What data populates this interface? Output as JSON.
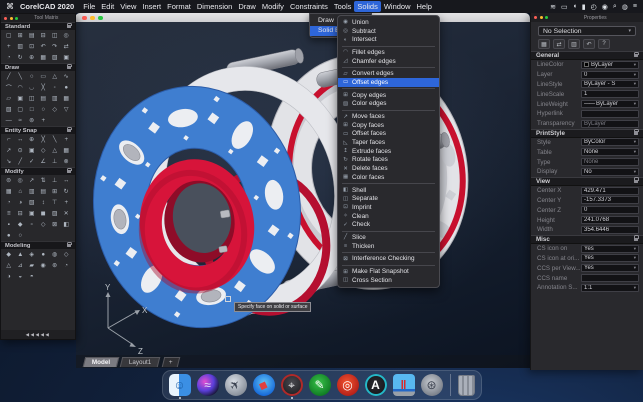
{
  "colors": {
    "accent_blue": "#2e66d9",
    "selection_blue": "#3f7ed0",
    "hub_red": "#d7143a",
    "titlebar_gray": "#d4d4d6"
  },
  "menubar": {
    "apple_logo": "⌘",
    "app_name": "CorelCAD 2020",
    "menus": [
      "File",
      "Edit",
      "View",
      "Insert",
      "Format",
      "Dimension",
      "Draw",
      "Modify",
      "Constraints",
      "Tools",
      "Solids",
      "Window",
      "Help"
    ],
    "active_menu": "Solids",
    "status_icons": [
      {
        "name": "wifi-icon",
        "glyph": "≋"
      },
      {
        "name": "display-icon",
        "glyph": "▭"
      },
      {
        "name": "volume-icon",
        "glyph": "◖"
      },
      {
        "name": "battery-icon",
        "glyph": "▮"
      },
      {
        "name": "clock-icon",
        "glyph": "◴"
      },
      {
        "name": "user-icon",
        "glyph": "◉"
      },
      {
        "name": "search-icon",
        "glyph": "⌕"
      },
      {
        "name": "siri-icon",
        "glyph": "◍"
      },
      {
        "name": "menu-list-icon",
        "glyph": "≡"
      }
    ]
  },
  "solids_menu": {
    "items": [
      {
        "label": "Draw",
        "active": false
      },
      {
        "label": "Solid Editing",
        "active": true
      }
    ]
  },
  "solid_editing_submenu": {
    "highlighted": "Offset edges",
    "groups": [
      [
        {
          "label": "Union",
          "glyph": "◉"
        },
        {
          "label": "Subtract",
          "glyph": "◎"
        },
        {
          "label": "Intersect",
          "glyph": "◐"
        }
      ],
      [
        {
          "label": "Fillet edges",
          "glyph": "◠"
        },
        {
          "label": "Chamfer edges",
          "glyph": "◿"
        }
      ],
      [
        {
          "label": "Convert edges",
          "glyph": "▱"
        },
        {
          "label": "Offset edges",
          "glyph": "▭"
        }
      ],
      [
        {
          "label": "Copy edges",
          "glyph": "⊞"
        },
        {
          "label": "Color edges",
          "glyph": "▨"
        }
      ],
      [
        {
          "label": "Move faces",
          "glyph": "↗"
        },
        {
          "label": "Copy faces",
          "glyph": "⊞"
        },
        {
          "label": "Offset faces",
          "glyph": "▭"
        },
        {
          "label": "Taper faces",
          "glyph": "◺"
        },
        {
          "label": "Extrude faces",
          "glyph": "↥"
        },
        {
          "label": "Rotate faces",
          "glyph": "↻"
        },
        {
          "label": "Delete faces",
          "glyph": "✕"
        },
        {
          "label": "Color faces",
          "glyph": "▦"
        }
      ],
      [
        {
          "label": "Shell",
          "glyph": "◧"
        },
        {
          "label": "Separate",
          "glyph": "◫"
        },
        {
          "label": "Imprint",
          "glyph": "⊡"
        },
        {
          "label": "Clean",
          "glyph": "✧"
        },
        {
          "label": "Check",
          "glyph": "✓"
        }
      ],
      [
        {
          "label": "Slice",
          "glyph": "╱"
        },
        {
          "label": "Thicken",
          "glyph": "≡"
        }
      ],
      [
        {
          "label": "Interference Checking",
          "glyph": "⊠"
        }
      ],
      [
        {
          "label": "Make Flat Snapshot",
          "glyph": "⊞"
        },
        {
          "label": "Cross Section",
          "glyph": "◫"
        }
      ]
    ]
  },
  "tool_matrix": {
    "title": "Tool Matrix",
    "pager": "◀◀◀◀◀",
    "sections": [
      {
        "name": "Standard",
        "icons": [
          "▢",
          "⊞",
          "▤",
          "⊟",
          "◫",
          "◎",
          "+",
          "▥",
          "⊡",
          "↶",
          "↷",
          "⇄",
          "◔",
          "↻",
          "⊕",
          "▦",
          "▧",
          "▣"
        ]
      },
      {
        "name": "Draw",
        "icons": [
          "╱",
          "╲",
          "○",
          "▭",
          "△",
          "∿",
          "⌒",
          "◠",
          "◡",
          "╳",
          "◦",
          "●",
          "▱",
          "▣",
          "◫",
          "▤",
          "▥",
          "▦",
          "▧",
          "▢",
          "□",
          "○",
          "◇",
          "▽",
          "―",
          "≈",
          "⊚",
          "+"
        ]
      },
      {
        "name": "Entity Snap",
        "icons": [
          "⌐",
          "↔",
          "⊕",
          "╳",
          "╲",
          "+",
          "↗",
          "⊙",
          "▣",
          "◇",
          "△",
          "▦",
          "↘",
          "╱",
          "✓",
          "∠",
          "⊥",
          "⊗"
        ]
      },
      {
        "name": "Modify",
        "icons": [
          "⊜",
          "◎",
          "↗",
          "⇅",
          "⊥",
          "↔",
          "▦",
          "⌂",
          "▥",
          "▤",
          "⊞",
          "↻",
          "◔",
          "◑",
          "▧",
          "↕",
          "⊤",
          "+",
          "≡",
          "⊟",
          "▣",
          "◼",
          "▨",
          "✕",
          "▪",
          "◆",
          "▫",
          "◇",
          "⊠",
          "◧",
          "●",
          "○"
        ]
      },
      {
        "name": "Modeling",
        "icons": [
          "◆",
          "▲",
          "◈",
          "●",
          "◍",
          "◇",
          "△",
          "⊿",
          "▰",
          "◉",
          "⊛",
          "◔",
          "◑",
          "◒",
          "◓"
        ]
      }
    ]
  },
  "viewport": {
    "tooltip": "Specify face on solid or surface",
    "axis": {
      "x": "X",
      "y": "Y",
      "z": "Z"
    },
    "tabs": [
      {
        "label": "Model",
        "active": true
      },
      {
        "label": "Layout1",
        "active": false
      },
      {
        "label": "+",
        "active": false
      }
    ]
  },
  "properties": {
    "title": "Properties",
    "selector": "No Selection",
    "toolbar_icons": [
      {
        "name": "match-properties-icon",
        "glyph": "▦"
      },
      {
        "name": "swap-icon",
        "glyph": "⇄"
      },
      {
        "name": "table-icon",
        "glyph": "▥"
      },
      {
        "name": "undo-icon",
        "glyph": "↶"
      },
      {
        "name": "help-icon",
        "glyph": "?"
      }
    ],
    "sections": [
      {
        "name": "General",
        "rows": [
          {
            "label": "LineColor",
            "value": "ByLayer",
            "type": "dropdown",
            "swatch": "#000000"
          },
          {
            "label": "Layer",
            "value": "0",
            "type": "dropdown"
          },
          {
            "label": "LineStyle",
            "value": "ByLayer - S",
            "type": "dropdown"
          },
          {
            "label": "LineScale",
            "value": "1",
            "type": "input"
          },
          {
            "label": "LineWeight",
            "value": "ByLayer",
            "type": "dropdown",
            "prefix": "——"
          },
          {
            "label": "Hyperlink",
            "value": "",
            "type": "input"
          },
          {
            "label": "Transparency",
            "value": "ByLayer",
            "type": "plain"
          }
        ]
      },
      {
        "name": "PrintStyle",
        "rows": [
          {
            "label": "Style",
            "value": "ByColor",
            "type": "dropdown"
          },
          {
            "label": "Table",
            "value": "None",
            "type": "dropdown"
          },
          {
            "label": "Type",
            "value": "None",
            "type": "plain"
          },
          {
            "label": "Display",
            "value": "No",
            "type": "dropdown"
          }
        ]
      },
      {
        "name": "View",
        "rows": [
          {
            "label": "Center X",
            "value": "429.471",
            "type": "input"
          },
          {
            "label": "Center Y",
            "value": "-157.3373",
            "type": "input"
          },
          {
            "label": "Center Z",
            "value": "0",
            "type": "input"
          },
          {
            "label": "Height",
            "value": "241.0768",
            "type": "input"
          },
          {
            "label": "Width",
            "value": "354.6446",
            "type": "input"
          }
        ]
      },
      {
        "name": "Misc",
        "rows": [
          {
            "label": "CS icon on",
            "value": "Yes",
            "type": "dropdown"
          },
          {
            "label": "CS icon at ori...",
            "value": "Yes",
            "type": "dropdown"
          },
          {
            "label": "CCS per View...",
            "value": "Yes",
            "type": "dropdown"
          },
          {
            "label": "CCS name",
            "value": "",
            "type": "input"
          },
          {
            "label": "Annotation S...",
            "value": "1:1",
            "type": "dropdown"
          }
        ]
      }
    ]
  },
  "dock": {
    "items": [
      {
        "name": "finder",
        "shape": "square",
        "bg": "linear-gradient(90deg,#e9f4fd 0 45%,#3b8fe4 45%)",
        "glyph": "☺",
        "fg": "#1b5fa8",
        "running": true
      },
      {
        "name": "siri",
        "shape": "circle",
        "bg": "radial-gradient(circle at 35% 35%, #e24fd0, #5a3fd8 45%, #121228 80%)",
        "glyph": "≈",
        "fg": "#e8e8ff"
      },
      {
        "name": "launchpad",
        "shape": "circle",
        "bg": "radial-gradient(circle at 40% 35%, #d8dde4, #8d949f 70%, #5c6470)",
        "glyph": "✈",
        "fg": "#3a4150",
        "rot": -45
      },
      {
        "name": "safari",
        "shape": "circle",
        "bg": "radial-gradient(circle at 50% 40%, #62c5f5, #1668d8 75%)",
        "glyph": "◆",
        "fg": "#e04040",
        "rot": 20
      },
      {
        "name": "corelcad",
        "shape": "circle",
        "bg": "radial-gradient(circle at 50% 40%, #4a4a50, #222226 70%)",
        "border": "#b02a2a",
        "glyph": "⌖",
        "fg": "#e8e8ea",
        "running": true
      },
      {
        "name": "pencil-app",
        "shape": "circle",
        "bg": "radial-gradient(circle at 45% 40%, #39c24a, #0f7a22 75%)",
        "glyph": "✎",
        "fg": "#ffffff"
      },
      {
        "name": "photo-app",
        "shape": "circle",
        "bg": "radial-gradient(circle at 45% 40%, #f25430, #b41f18 75%)",
        "glyph": "◎",
        "fg": "#ffffff"
      },
      {
        "name": "letter-a-app",
        "shape": "circle",
        "bg": "radial-gradient(circle at 50% 45%, #2b2b30, #141418 80%)",
        "border": "#25b8c8",
        "glyph": "A",
        "fg": "#ffffff",
        "bold": true
      },
      {
        "name": "display-app",
        "shape": "monitor",
        "bg": "linear-gradient(180deg,#58b8f0 0 68%,#2468c8 68% 80%,#9aa0a8 80%)",
        "glyph": "‖",
        "fg": "#e02020",
        "bold": true
      },
      {
        "name": "dial-app",
        "shape": "circle",
        "bg": "radial-gradient(circle at 45% 40%, #c8ccd2, #787e88 75%)",
        "glyph": "⊛",
        "fg": "#3c4250"
      },
      {
        "separator": true
      },
      {
        "name": "trash",
        "shape": "trash"
      }
    ]
  }
}
